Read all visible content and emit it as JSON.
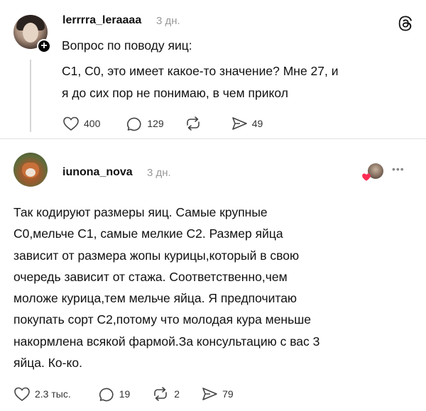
{
  "post": {
    "author": "lerrrra_leraaaa",
    "time": "3 дн.",
    "lines": [
      "Вопрос по поводу яиц:",
      "С1, С0, это имеет какое-то значение? Мне 27, и",
      "я до сих пор не понимаю, в чем прикол"
    ],
    "likes": "400",
    "replies": "129",
    "shares": "49"
  },
  "reply": {
    "author": "iunona_nova",
    "time": "3 дн.",
    "lines": [
      "Так кодируют размеры яиц. Самые крупные",
      "С0,мельче С1, самые мелкие С2. Размер яйца",
      "зависит от размера жопы курицы,который в свою",
      "очередь зависит от стажа. Соответственно,чем",
      "моложе курица,тем мельче яйца. Я предпочитаю",
      "покупать сорт С2,потому что молодая кура меньше",
      "накормлена всякой фармой.За консультацию с вас 3",
      "яйца. Ко-ко."
    ],
    "likes": "2.3 тыс.",
    "replies": "19",
    "reposts": "2",
    "shares": "79"
  },
  "colors": {
    "heart_badge": "#ff2d55",
    "muted": "#999999"
  },
  "icons": [
    "threads-logo-icon",
    "heart-icon",
    "comment-icon",
    "repost-icon",
    "share-icon",
    "more-icon",
    "follow-plus-icon"
  ]
}
